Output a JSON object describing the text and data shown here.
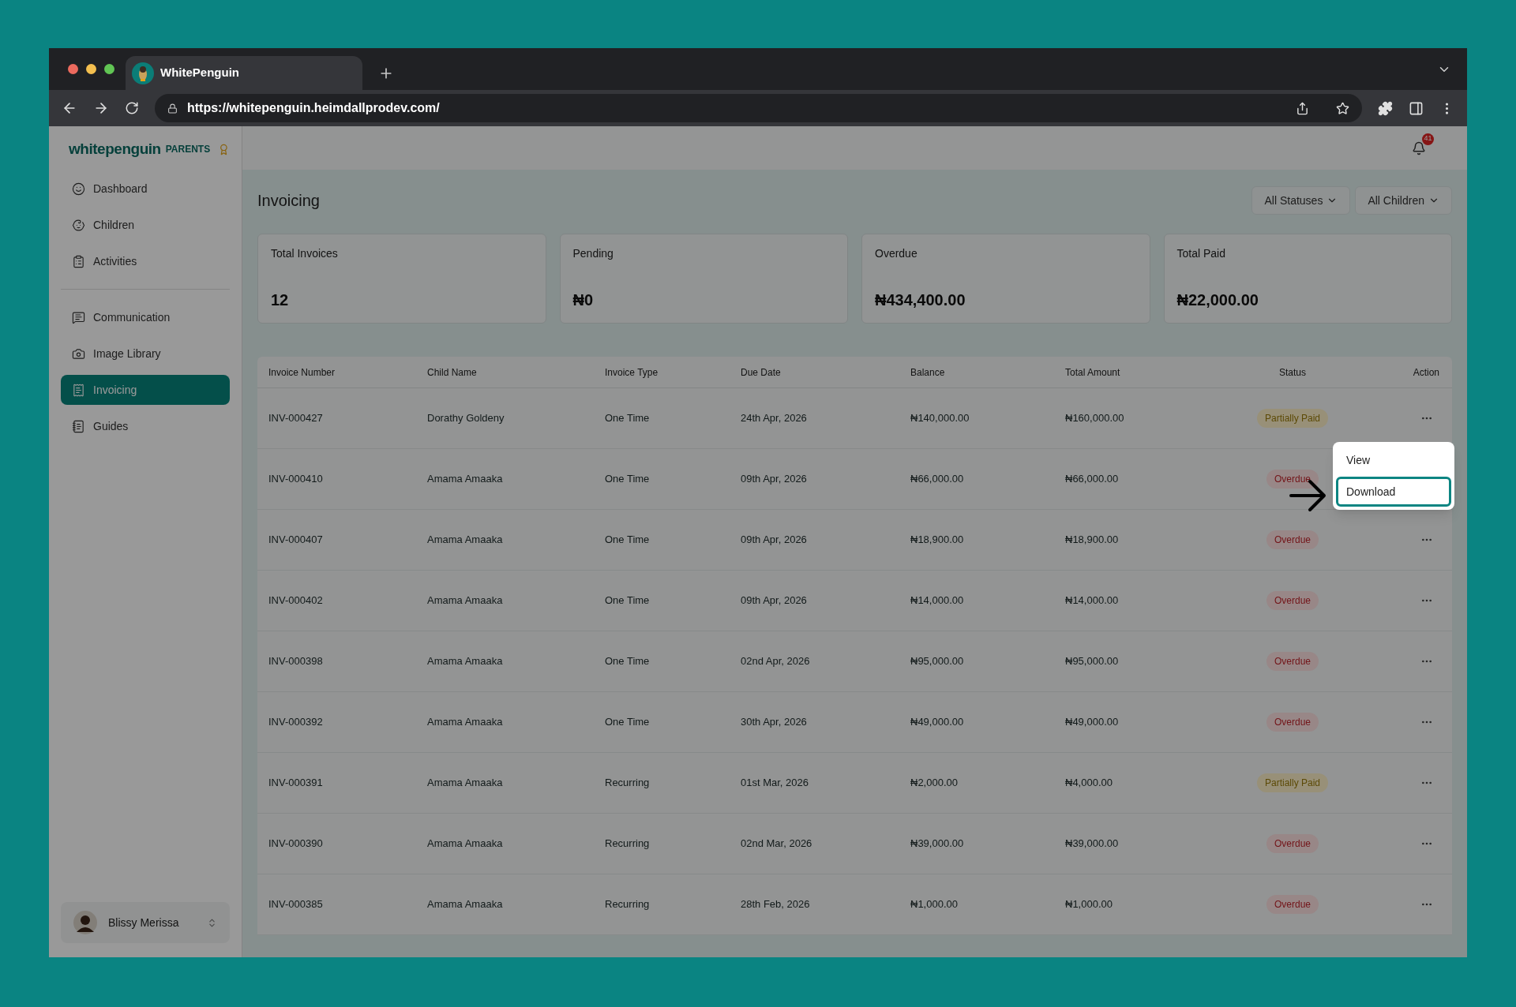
{
  "browser": {
    "tab_title": "WhitePenguin",
    "url": "https://whitepenguin.heimdallprodev.com/"
  },
  "sidebar": {
    "logo": "whitepenguin",
    "logo_suffix": "PARENTS",
    "sections": [
      {
        "items": [
          {
            "label": "Dashboard",
            "kind": "dashboard",
            "selected": false
          },
          {
            "label": "Children",
            "kind": "children",
            "selected": false
          },
          {
            "label": "Activities",
            "kind": "activities",
            "selected": false
          }
        ]
      },
      {
        "items": [
          {
            "label": "Communication",
            "kind": "communication",
            "selected": false
          },
          {
            "label": "Image Library",
            "kind": "images",
            "selected": false
          },
          {
            "label": "Invoicing",
            "kind": "invoicing",
            "selected": true
          },
          {
            "label": "Guides",
            "kind": "guides",
            "selected": false
          }
        ]
      }
    ],
    "user": {
      "name": "Blissy Merissa"
    }
  },
  "header": {
    "notification_count": "41"
  },
  "page": {
    "title": "Invoicing",
    "filters": [
      {
        "label": "All Statuses"
      },
      {
        "label": "All Children"
      }
    ]
  },
  "summary_cards": [
    {
      "label": "Total Invoices",
      "value": "12"
    },
    {
      "label": "Pending",
      "value": "₦0"
    },
    {
      "label": "Overdue",
      "value": "₦434,400.00"
    },
    {
      "label": "Total Paid",
      "value": "₦22,000.00"
    }
  ],
  "table": {
    "columns": [
      "Invoice Number",
      "Child Name",
      "Invoice Type",
      "Due Date",
      "Balance",
      "Total Amount",
      "Status",
      "Action"
    ],
    "rows": [
      {
        "cells": [
          "INV-000427",
          "Dorathy Goldeny",
          "One Time",
          "24th Apr, 2026",
          "₦140,000.00",
          "₦160,000.00"
        ],
        "status": {
          "label": "Partially Paid",
          "kind": "partial"
        }
      },
      {
        "cells": [
          "INV-000410",
          "Amama Amaaka",
          "One Time",
          "09th Apr, 2026",
          "₦66,000.00",
          "₦66,000.00"
        ],
        "status": {
          "label": "Overdue",
          "kind": "overdue"
        }
      },
      {
        "cells": [
          "INV-000407",
          "Amama Amaaka",
          "One Time",
          "09th Apr, 2026",
          "₦18,900.00",
          "₦18,900.00"
        ],
        "status": {
          "label": "Overdue",
          "kind": "overdue"
        }
      },
      {
        "cells": [
          "INV-000402",
          "Amama Amaaka",
          "One Time",
          "09th Apr, 2026",
          "₦14,000.00",
          "₦14,000.00"
        ],
        "status": {
          "label": "Overdue",
          "kind": "overdue"
        }
      },
      {
        "cells": [
          "INV-000398",
          "Amama Amaaka",
          "One Time",
          "02nd Apr, 2026",
          "₦95,000.00",
          "₦95,000.00"
        ],
        "status": {
          "label": "Overdue",
          "kind": "overdue"
        }
      },
      {
        "cells": [
          "INV-000392",
          "Amama Amaaka",
          "One Time",
          "30th Apr, 2026",
          "₦49,000.00",
          "₦49,000.00"
        ],
        "status": {
          "label": "Overdue",
          "kind": "overdue"
        }
      },
      {
        "cells": [
          "INV-000391",
          "Amama Amaaka",
          "Recurring",
          "01st Mar, 2026",
          "₦2,000.00",
          "₦4,000.00"
        ],
        "status": {
          "label": "Partially Paid",
          "kind": "partial"
        }
      },
      {
        "cells": [
          "INV-000390",
          "Amama Amaaka",
          "Recurring",
          "02nd Mar, 2026",
          "₦39,000.00",
          "₦39,000.00"
        ],
        "status": {
          "label": "Overdue",
          "kind": "overdue"
        }
      },
      {
        "cells": [
          "INV-000385",
          "Amama Amaaka",
          "Recurring",
          "28th Feb, 2026",
          "₦1,000.00",
          "₦1,000.00"
        ],
        "status": {
          "label": "Overdue",
          "kind": "overdue"
        }
      }
    ]
  },
  "action_menu": {
    "open": true,
    "items": [
      {
        "label": "View",
        "selected": false
      },
      {
        "label": "Download",
        "selected": true
      }
    ]
  }
}
